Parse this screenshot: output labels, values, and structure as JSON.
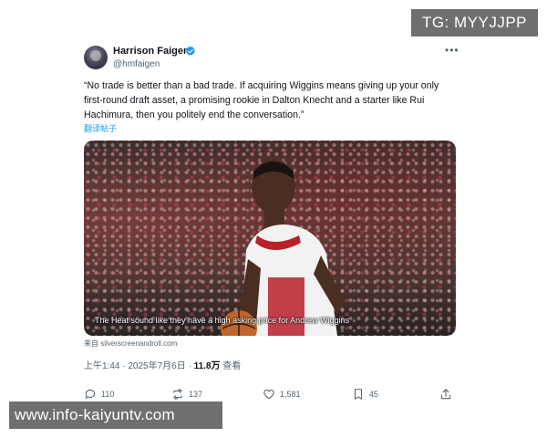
{
  "watermark_tg": "TG: MYYJJPP",
  "watermark_url": "www.info-kaiyuntv.com",
  "tweet": {
    "author_name": "Harrison Faigen",
    "author_handle": "@hmfaigen",
    "text": "“No trade is better than a bad trade. If acquiring Wiggins means giving up your only first-round draft asset, a promising rookie in Dalton Knecht and a starter like Rui Hachimura, then you politely end the conversation.”",
    "translate_label": "翻译帖子",
    "media_caption": "The Heat sound like they have a high asking price for Andrew Wiggins",
    "source": "来自 silverscreenandroll.com",
    "time": "上午1:44 · 2025年7月6日 · ",
    "views_count": "11.8万",
    "views_label": " 查看",
    "replies": "110",
    "reposts": "137",
    "likes": "1,581",
    "bookmarks": "45"
  },
  "colors": {
    "accent": "#1d9bf0",
    "text": "#0f1419",
    "muted": "#536471",
    "watermark_bg": "#6f6f6f"
  },
  "icons": [
    "verified-badge-icon",
    "more-icon",
    "reply-icon",
    "repost-icon",
    "like-icon",
    "bookmark-icon",
    "share-icon"
  ]
}
